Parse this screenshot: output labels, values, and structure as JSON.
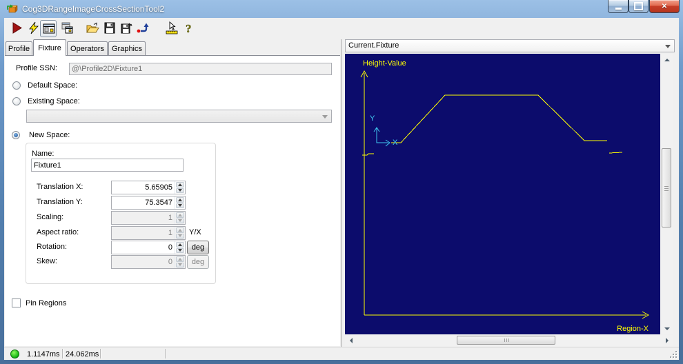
{
  "window": {
    "title": "Cog3DRangeImageCrossSectionTool2",
    "icon": "tool-cube-icon",
    "controls": {
      "minimize": "minimize",
      "maximize": "maximize",
      "close": "close"
    }
  },
  "toolbar": {
    "icons": [
      "run-icon",
      "lightning-icon",
      "tool-display-icon",
      "float-display-icon",
      "open-icon",
      "save-icon",
      "save-as-icon",
      "reset-icon",
      "measure-icon",
      "help-icon"
    ]
  },
  "tabs": {
    "active": "Fixture",
    "items": [
      {
        "label": "Profile"
      },
      {
        "label": "Fixture"
      },
      {
        "label": "Operators"
      },
      {
        "label": "Graphics"
      }
    ]
  },
  "form": {
    "profile_ssn_label": "Profile SSN:",
    "profile_ssn_value": "@\\Profile2D\\Fixture1",
    "default_space_label": "Default Space:",
    "existing_space_label": "Existing Space:",
    "existing_space_value": "",
    "new_space_label": "New Space:",
    "name_label": "Name:",
    "name_value": "Fixture1",
    "rows": {
      "tx": {
        "label": "Translation X:",
        "value": "5.65905"
      },
      "ty": {
        "label": "Translation Y:",
        "value": "75.3547"
      },
      "scaling": {
        "label": "Scaling:",
        "value": "1"
      },
      "aspect": {
        "label": "Aspect ratio:",
        "value": "1",
        "suffix": "Y/X"
      },
      "rotation": {
        "label": "Rotation:",
        "value": "0",
        "unit": "deg"
      },
      "skew": {
        "label": "Skew:",
        "value": "0",
        "unit": "deg"
      }
    },
    "pin_regions_label": "Pin Regions"
  },
  "display": {
    "selector_value": "Current.Fixture",
    "plot": {
      "type": "line",
      "background": "#0c0c6c",
      "profile_color": "#ffff00",
      "marker_color": "#3fc8f0",
      "y_axis_label": "Height-Value",
      "x_axis_label": "Region-X",
      "marker_x_label": "X",
      "marker_y_label": "Y",
      "segments": [
        "25,147 32,147 34,145 42,145",
        "67,129 81,129 145,60 280,60 347,126 380,126",
        "383,144 402,143"
      ]
    }
  },
  "statusbar": {
    "status_color": "#22c32a",
    "run_time": "1.1147ms",
    "total_time": "24.062ms"
  }
}
